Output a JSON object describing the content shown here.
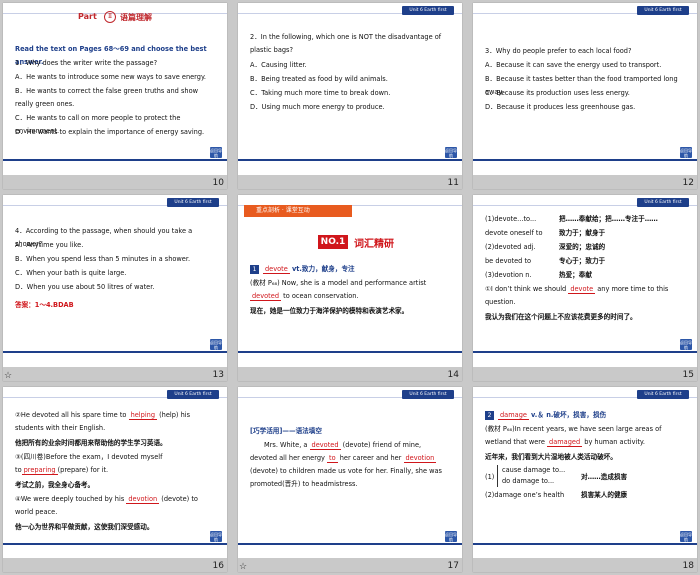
{
  "unit_tab": "Unit 6  Earth first",
  "nav_label": "返回导航",
  "star": "☆",
  "slides": {
    "s10": {
      "number": "10",
      "part_label": "Part",
      "part_roman": "Ⅱ",
      "part_cn": "语篇理解",
      "instruction": "Read the text on Pages 68～69 and choose the best answer.",
      "question": "1．Why does the writer write the passage?",
      "options": [
        "A．He wants to introduce some new ways to save energy.",
        "B．He wants to correct the false green truths and show really green ones.",
        "C．He wants to call on more people to protect the environment.",
        "D．He wants to explain the importance of energy saving."
      ]
    },
    "s11": {
      "number": "11",
      "question": "2．In the following, which one is NOT the disadvantage of plastic bags?",
      "options": [
        "A．Causing litter.",
        "B．Being treated as food by wild animals.",
        "C．Taking much more time to break down.",
        "D．Using much more energy to produce."
      ]
    },
    "s12": {
      "number": "12",
      "question": "3．Why do people prefer to each local food?",
      "options": [
        "A．Because it can save the energy used to transport.",
        "B．Because it tastes better than the food tramported long away.",
        "C．Because its production uses less energy.",
        "D．Because it produces less greenhouse gas."
      ]
    },
    "s13": {
      "number": "13",
      "question": "4．According to the passage, when should you take a shower?",
      "options": [
        "A．Anytime you like.",
        "B．When you spend less than 5 minutes in a shower.",
        "C．When your bath is quite large.",
        "D．When you use about 50 litres of water."
      ],
      "answer": "答案：1～4.BDAB"
    },
    "s14": {
      "number": "14",
      "banner": "重点剖析 · 课堂互动",
      "no_label": "NO.1",
      "section_title": "词汇精研",
      "word_index": "1",
      "word": "devote",
      "word_def": "vt.致力，献身，专注",
      "example_prefix": "(教材 P₆₈) Now, she is a model and performance artist ",
      "example_word": "devoted",
      "example_suffix": " to ocean conservation.",
      "translation": "现在，她是一位致力于海洋保护的模特和表演艺术家。"
    },
    "s15": {
      "number": "15",
      "rows": [
        {
          "en": "(1)devote...to...",
          "cn": "把……奉献给；把……专注于……"
        },
        {
          "en": "devote oneself to",
          "cn": "致力于；献身于"
        },
        {
          "en": "(2)devoted adj.",
          "cn": "深爱的；忠诚的"
        },
        {
          "en": "be devoted to",
          "cn": "专心于；致力于"
        },
        {
          "en": "(3)devotion n.",
          "cn": "热爱；奉献"
        }
      ],
      "example_prefix": "①I don’t think we should ",
      "example_word": "devote",
      "example_suffix": " any more time to this question.",
      "translation": "我认为我们在这个问题上不应该花费更多的时间了。"
    },
    "s16": {
      "number": "16",
      "s1_prefix": "②He devoted all his spare time to ",
      "s1_word": "helping",
      "s1_suffix": " (help) his students with their English.",
      "s1_cn": "他把所有的业余时间都用来帮助他的学生学习英语。",
      "s2_prefix": "③(四川卷)Before the exam，I devoted myself to",
      "s2_word": "preparing",
      "s2_suffix": "(prepare) for it.",
      "s2_cn": "考试之前，我全身心备考。",
      "s3_prefix": "④We were deeply touched by his ",
      "s3_word": "devotion",
      "s3_suffix": " (devote) to world peace.",
      "s3_cn": "他一心为世界和平做贡献，这使我们深受感动。"
    },
    "s17": {
      "number": "17",
      "heading": "[巧学活用]——语法填空",
      "t1": "Mrs. White, a ",
      "w1": "devoted",
      "t2": " (devote) friend of mine, devoted all her energy ",
      "w2": "to",
      "t3": " her career and her ",
      "w3": "devotion",
      "t4": " (devote) to children made us vote for her. Finally, she was promoted(晋升) to headmistress."
    },
    "s18": {
      "number": "18",
      "word_index": "2",
      "word": "damage",
      "word_def": "v.＆ n.破坏，损害，损伤",
      "example_prefix": "(教材 P₆₈)In recent years, we have seen large areas of wetland that were ",
      "example_word": "damaged",
      "example_suffix": " by human activity.",
      "translation": "近年来，我们看到大片湿地被人类活动破坏。",
      "r1_a": "cause damage to...",
      "r1_b": "do damage to...",
      "r1_cn": "对……造成损害",
      "r2_en": "(2)damage one’s health",
      "r2_cn": "损害某人的健康"
    }
  }
}
